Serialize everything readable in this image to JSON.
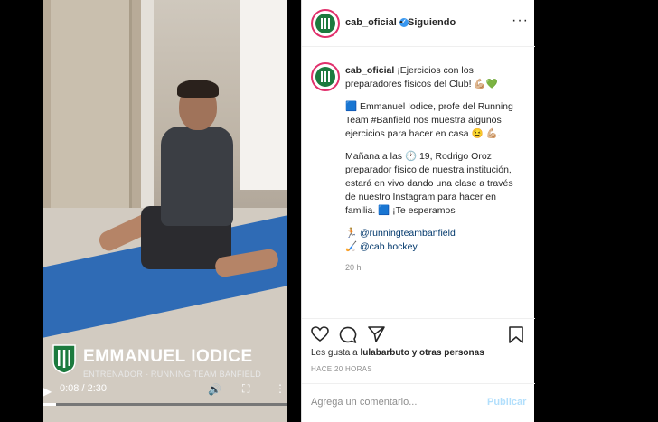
{
  "video": {
    "overlay_name": "EMMANUEL IODICE",
    "overlay_role": "ENTRENADOR - RUNNING TEAM BANFIELD",
    "time": "0:08 / 2:30",
    "progress": 0.053,
    "icons": {
      "play": "play-icon",
      "volume": "volume-icon",
      "fullscreen": "fullscreen-icon",
      "more": "more-vertical-icon"
    }
  },
  "header": {
    "username": "cab_oficial",
    "dot": "•",
    "follow_status": "Siguiendo",
    "menu": "···"
  },
  "post": {
    "username": "cab_oficial",
    "line1": "¡Ejercicios con los preparadores físicos del Club! 💪🏼💚",
    "line2": "🟦 Emmanuel Iodice, profe del Running Team #Banfield nos muestra algunos ejercicios para hacer en casa 😉 💪🏼.",
    "line3": "Mañana a las 🕐 19, Rodrigo Oroz preparador físico de nuestra institución, estará en vivo dando una clase a través de nuestro Instagram para hacer en familia. 🟦 ¡Te esperamos",
    "mention1": "🏃🏼 @runningteambanfield",
    "mention2": "🏑 @cab.hockey",
    "ago": "20 h"
  },
  "actions": {
    "like": "like-heart-icon",
    "comment": "comment-icon",
    "share": "share-icon",
    "save": "bookmark-icon"
  },
  "likes": {
    "prefix": "Les gusta a ",
    "user": "lulabarbuto",
    "suffix": " y otras personas"
  },
  "date": "HACE 20 HORAS",
  "comment_box": {
    "placeholder": "Agrega un comentario...",
    "post": "Publicar"
  },
  "colors": {
    "verified": "#3897f0",
    "mat": "#2f6bb5",
    "club_green": "#1c7a3e",
    "publish_disabled": "#b2dffc"
  }
}
